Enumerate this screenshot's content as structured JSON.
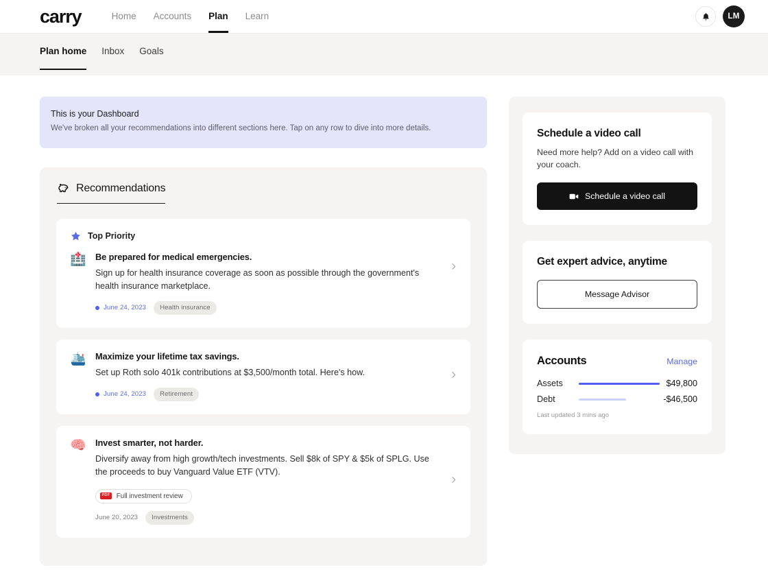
{
  "header": {
    "logo": "carry",
    "nav": [
      {
        "label": "Home",
        "active": false
      },
      {
        "label": "Accounts",
        "active": false
      },
      {
        "label": "Plan",
        "active": true
      },
      {
        "label": "Learn",
        "active": false
      }
    ],
    "notifications_icon": "bell-icon",
    "avatar_initials": "LM"
  },
  "subnav": [
    {
      "label": "Plan home",
      "active": true
    },
    {
      "label": "Inbox",
      "active": false
    },
    {
      "label": "Goals",
      "active": false
    }
  ],
  "banner": {
    "title": "This is your Dashboard",
    "subtitle": "We've broken all your recommendations into different sections here. Tap on any row to dive into more details.",
    "background_color": "#e4e4fb"
  },
  "panel": {
    "tab_label": "Recommendations",
    "tab_icon": "piggy-bank-icon"
  },
  "recommendations": [
    {
      "priority_label": "Top Priority",
      "priority_icon": "star-icon",
      "emoji": "🏥",
      "emoji_name": "hospital-icon",
      "title": "Be prepared for medical emergencies.",
      "description": "Sign up for health insurance coverage as soon as possible through the government's health insurance marketplace.",
      "date": "June 24, 2023",
      "date_highlighted": true,
      "tag": "Health insurance"
    },
    {
      "emoji": "🛳️",
      "emoji_name": "cruise-ship-icon",
      "title": "Maximize your lifetime tax savings.",
      "description": "Set up Roth solo 401k contributions at $3,500/month total. Here's how.",
      "date": "June 24, 2023",
      "date_highlighted": true,
      "tag": "Retirement"
    },
    {
      "emoji": "🧠",
      "emoji_name": "brain-icon",
      "title": "Invest smarter, not harder.",
      "description": "Diversify away from high growth/tech investments. Sell $8k of SPY & $5k of SPLG. Use the proceeds to buy Vanguard Value ETF (VTV).",
      "attachment": {
        "badge": "PDF",
        "label": "Full investment review"
      },
      "date": "June 20, 2023",
      "date_highlighted": false,
      "tag": "Investments"
    }
  ],
  "sidebar": {
    "video_call": {
      "title": "Schedule a video call",
      "description": "Need more help? Add on a video call with your coach.",
      "button_label": "Schedule a video call",
      "button_icon": "video-camera-icon"
    },
    "advisor": {
      "title": "Get expert advice, anytime",
      "button_label": "Message Advisor"
    },
    "accounts": {
      "title": "Accounts",
      "manage_label": "Manage",
      "rows": [
        {
          "label": "Assets",
          "value": "$49,800",
          "bar_percent": 100,
          "bar_color": "#4f5ef0"
        },
        {
          "label": "Debt",
          "value": "-$46,500",
          "bar_percent": 60,
          "bar_color": "#ccd2fa"
        }
      ],
      "updated": "Last updated 3 mins ago"
    }
  },
  "colors": {
    "accent": "#5b6ae8",
    "bar_strong": "#4f5ef0",
    "bar_light": "#ccd2fa",
    "panel_bg": "#f5f4f2",
    "banner_bg": "#e4e4fb",
    "pdf_red": "#d81f26"
  }
}
